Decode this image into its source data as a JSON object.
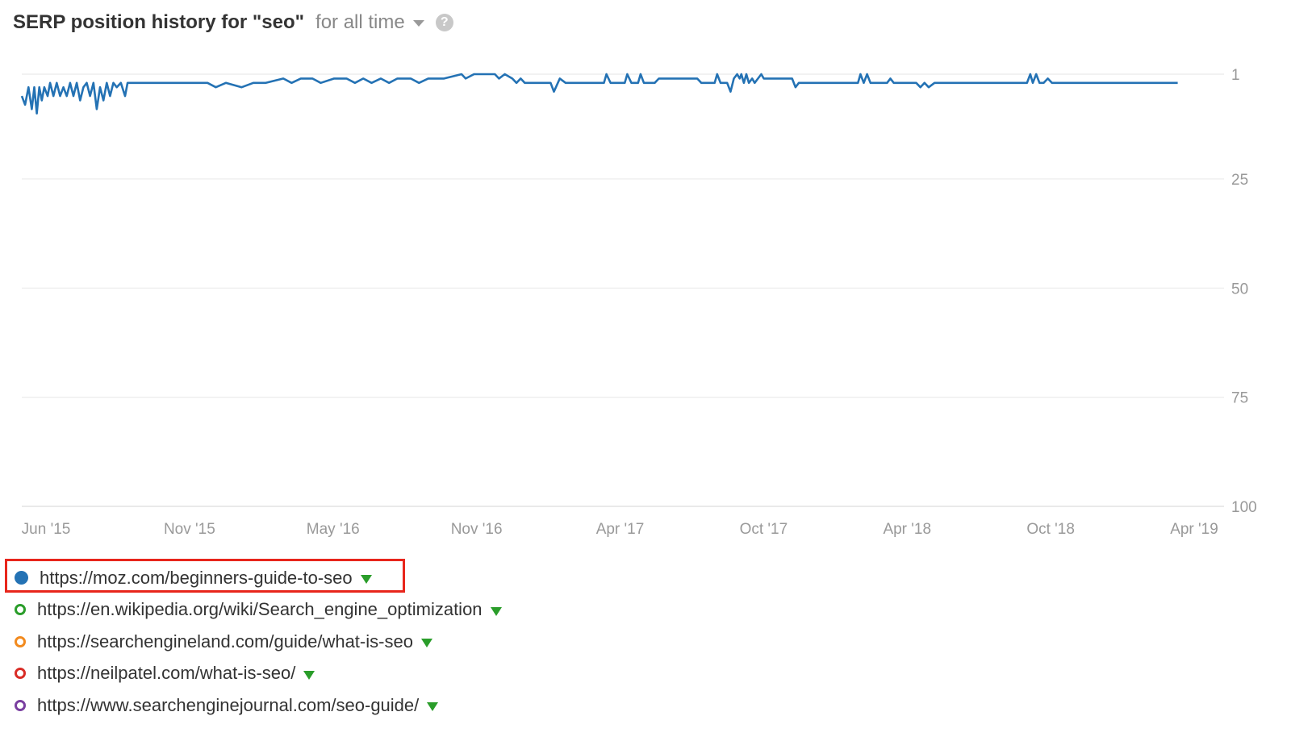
{
  "header": {
    "title": "SERP position history for \"seo\"",
    "range_label": "for all time",
    "help_glyph": "?"
  },
  "chart_data": {
    "type": "line",
    "title": "SERP position history for \"seo\"",
    "xlabel": "",
    "ylabel": "",
    "y_inverted": true,
    "ylim": [
      1,
      100
    ],
    "y_ticks": [
      1,
      25,
      50,
      75,
      100
    ],
    "x_ticks": [
      "Jun '15",
      "Nov '15",
      "May '16",
      "Nov '16",
      "Apr '17",
      "Oct '17",
      "Apr '18",
      "Oct '18",
      "Apr '19"
    ],
    "x_range": [
      "2015-06-01",
      "2019-04-01"
    ],
    "grid": true,
    "series": [
      {
        "name": "https://moz.com/beginners-guide-to-seo",
        "color": "#2472b4",
        "points": [
          [
            "2015-06-01",
            6
          ],
          [
            "2015-06-05",
            8
          ],
          [
            "2015-06-09",
            4
          ],
          [
            "2015-06-13",
            9
          ],
          [
            "2015-06-16",
            4
          ],
          [
            "2015-06-19",
            10
          ],
          [
            "2015-06-22",
            4
          ],
          [
            "2015-06-25",
            7
          ],
          [
            "2015-06-28",
            4
          ],
          [
            "2015-07-02",
            6
          ],
          [
            "2015-07-05",
            3
          ],
          [
            "2015-07-09",
            6
          ],
          [
            "2015-07-13",
            3
          ],
          [
            "2015-07-17",
            6
          ],
          [
            "2015-07-21",
            4
          ],
          [
            "2015-07-25",
            6
          ],
          [
            "2015-07-29",
            3
          ],
          [
            "2015-08-02",
            6
          ],
          [
            "2015-08-06",
            3
          ],
          [
            "2015-08-10",
            7
          ],
          [
            "2015-08-14",
            4
          ],
          [
            "2015-08-18",
            3
          ],
          [
            "2015-08-22",
            6
          ],
          [
            "2015-08-26",
            3
          ],
          [
            "2015-08-30",
            9
          ],
          [
            "2015-09-03",
            4
          ],
          [
            "2015-09-07",
            7
          ],
          [
            "2015-09-11",
            3
          ],
          [
            "2015-09-15",
            6
          ],
          [
            "2015-09-19",
            3
          ],
          [
            "2015-09-23",
            4
          ],
          [
            "2015-09-28",
            3
          ],
          [
            "2015-10-03",
            6
          ],
          [
            "2015-10-06",
            3
          ],
          [
            "2015-11-01",
            3
          ],
          [
            "2015-12-01",
            3
          ],
          [
            "2016-01-10",
            3
          ],
          [
            "2016-01-20",
            4
          ],
          [
            "2016-02-01",
            3
          ],
          [
            "2016-02-20",
            4
          ],
          [
            "2016-03-05",
            3
          ],
          [
            "2016-03-20",
            3
          ],
          [
            "2016-04-10",
            2
          ],
          [
            "2016-04-20",
            3
          ],
          [
            "2016-05-01",
            2
          ],
          [
            "2016-05-15",
            2
          ],
          [
            "2016-05-25",
            3
          ],
          [
            "2016-06-10",
            2
          ],
          [
            "2016-06-25",
            2
          ],
          [
            "2016-07-05",
            3
          ],
          [
            "2016-07-15",
            2
          ],
          [
            "2016-07-25",
            3
          ],
          [
            "2016-08-05",
            2
          ],
          [
            "2016-08-15",
            3
          ],
          [
            "2016-08-25",
            2
          ],
          [
            "2016-09-10",
            2
          ],
          [
            "2016-09-20",
            3
          ],
          [
            "2016-10-01",
            2
          ],
          [
            "2016-10-20",
            2
          ],
          [
            "2016-11-10",
            1
          ],
          [
            "2016-11-15",
            2
          ],
          [
            "2016-11-25",
            1
          ],
          [
            "2016-12-10",
            1
          ],
          [
            "2016-12-20",
            1
          ],
          [
            "2016-12-25",
            2
          ],
          [
            "2017-01-01",
            1
          ],
          [
            "2017-01-10",
            2
          ],
          [
            "2017-01-15",
            3
          ],
          [
            "2017-01-20",
            2
          ],
          [
            "2017-01-25",
            3
          ],
          [
            "2017-02-10",
            3
          ],
          [
            "2017-02-25",
            3
          ],
          [
            "2017-03-01",
            5
          ],
          [
            "2017-03-08",
            2
          ],
          [
            "2017-03-15",
            3
          ],
          [
            "2017-04-15",
            3
          ],
          [
            "2017-04-30",
            3
          ],
          [
            "2017-05-03",
            1
          ],
          [
            "2017-05-08",
            3
          ],
          [
            "2017-05-25",
            3
          ],
          [
            "2017-05-28",
            1
          ],
          [
            "2017-06-02",
            3
          ],
          [
            "2017-06-10",
            3
          ],
          [
            "2017-06-13",
            1
          ],
          [
            "2017-06-17",
            3
          ],
          [
            "2017-06-30",
            3
          ],
          [
            "2017-07-05",
            2
          ],
          [
            "2017-08-01",
            2
          ],
          [
            "2017-08-20",
            2
          ],
          [
            "2017-08-25",
            3
          ],
          [
            "2017-09-10",
            3
          ],
          [
            "2017-09-13",
            1
          ],
          [
            "2017-09-17",
            3
          ],
          [
            "2017-09-25",
            3
          ],
          [
            "2017-09-29",
            5
          ],
          [
            "2017-10-03",
            2
          ],
          [
            "2017-10-07",
            1
          ],
          [
            "2017-10-10",
            2
          ],
          [
            "2017-10-12",
            1
          ],
          [
            "2017-10-15",
            3
          ],
          [
            "2017-10-18",
            1
          ],
          [
            "2017-10-21",
            3
          ],
          [
            "2017-10-25",
            2
          ],
          [
            "2017-10-28",
            3
          ],
          [
            "2017-11-01",
            2
          ],
          [
            "2017-11-05",
            1
          ],
          [
            "2017-11-08",
            2
          ],
          [
            "2017-12-01",
            2
          ],
          [
            "2017-12-12",
            2
          ],
          [
            "2017-12-16",
            4
          ],
          [
            "2017-12-20",
            3
          ],
          [
            "2018-03-01",
            3
          ],
          [
            "2018-03-04",
            1
          ],
          [
            "2018-03-08",
            3
          ],
          [
            "2018-03-12",
            1
          ],
          [
            "2018-03-16",
            3
          ],
          [
            "2018-04-05",
            3
          ],
          [
            "2018-04-09",
            2
          ],
          [
            "2018-04-13",
            3
          ],
          [
            "2018-05-10",
            3
          ],
          [
            "2018-05-15",
            4
          ],
          [
            "2018-05-20",
            3
          ],
          [
            "2018-05-25",
            4
          ],
          [
            "2018-06-01",
            3
          ],
          [
            "2018-09-20",
            3
          ],
          [
            "2018-09-24",
            1
          ],
          [
            "2018-09-27",
            3
          ],
          [
            "2018-10-01",
            1
          ],
          [
            "2018-10-05",
            3
          ],
          [
            "2018-10-10",
            3
          ],
          [
            "2018-10-15",
            2
          ],
          [
            "2018-10-20",
            3
          ],
          [
            "2019-03-20",
            3
          ]
        ]
      }
    ]
  },
  "legend": [
    {
      "label": "https://moz.com/beginners-guide-to-seo",
      "color": "#2472b4",
      "filled": true,
      "selected": true
    },
    {
      "label": "https://en.wikipedia.org/wiki/Search_engine_optimization",
      "color": "#2a9d2a",
      "filled": false,
      "selected": false
    },
    {
      "label": "https://searchengineland.com/guide/what-is-seo",
      "color": "#f28a1e",
      "filled": false,
      "selected": false
    },
    {
      "label": "https://neilpatel.com/what-is-seo/",
      "color": "#d92c26",
      "filled": false,
      "selected": false
    },
    {
      "label": "https://www.searchenginejournal.com/seo-guide/",
      "color": "#7a3fa0",
      "filled": false,
      "selected": false
    }
  ]
}
